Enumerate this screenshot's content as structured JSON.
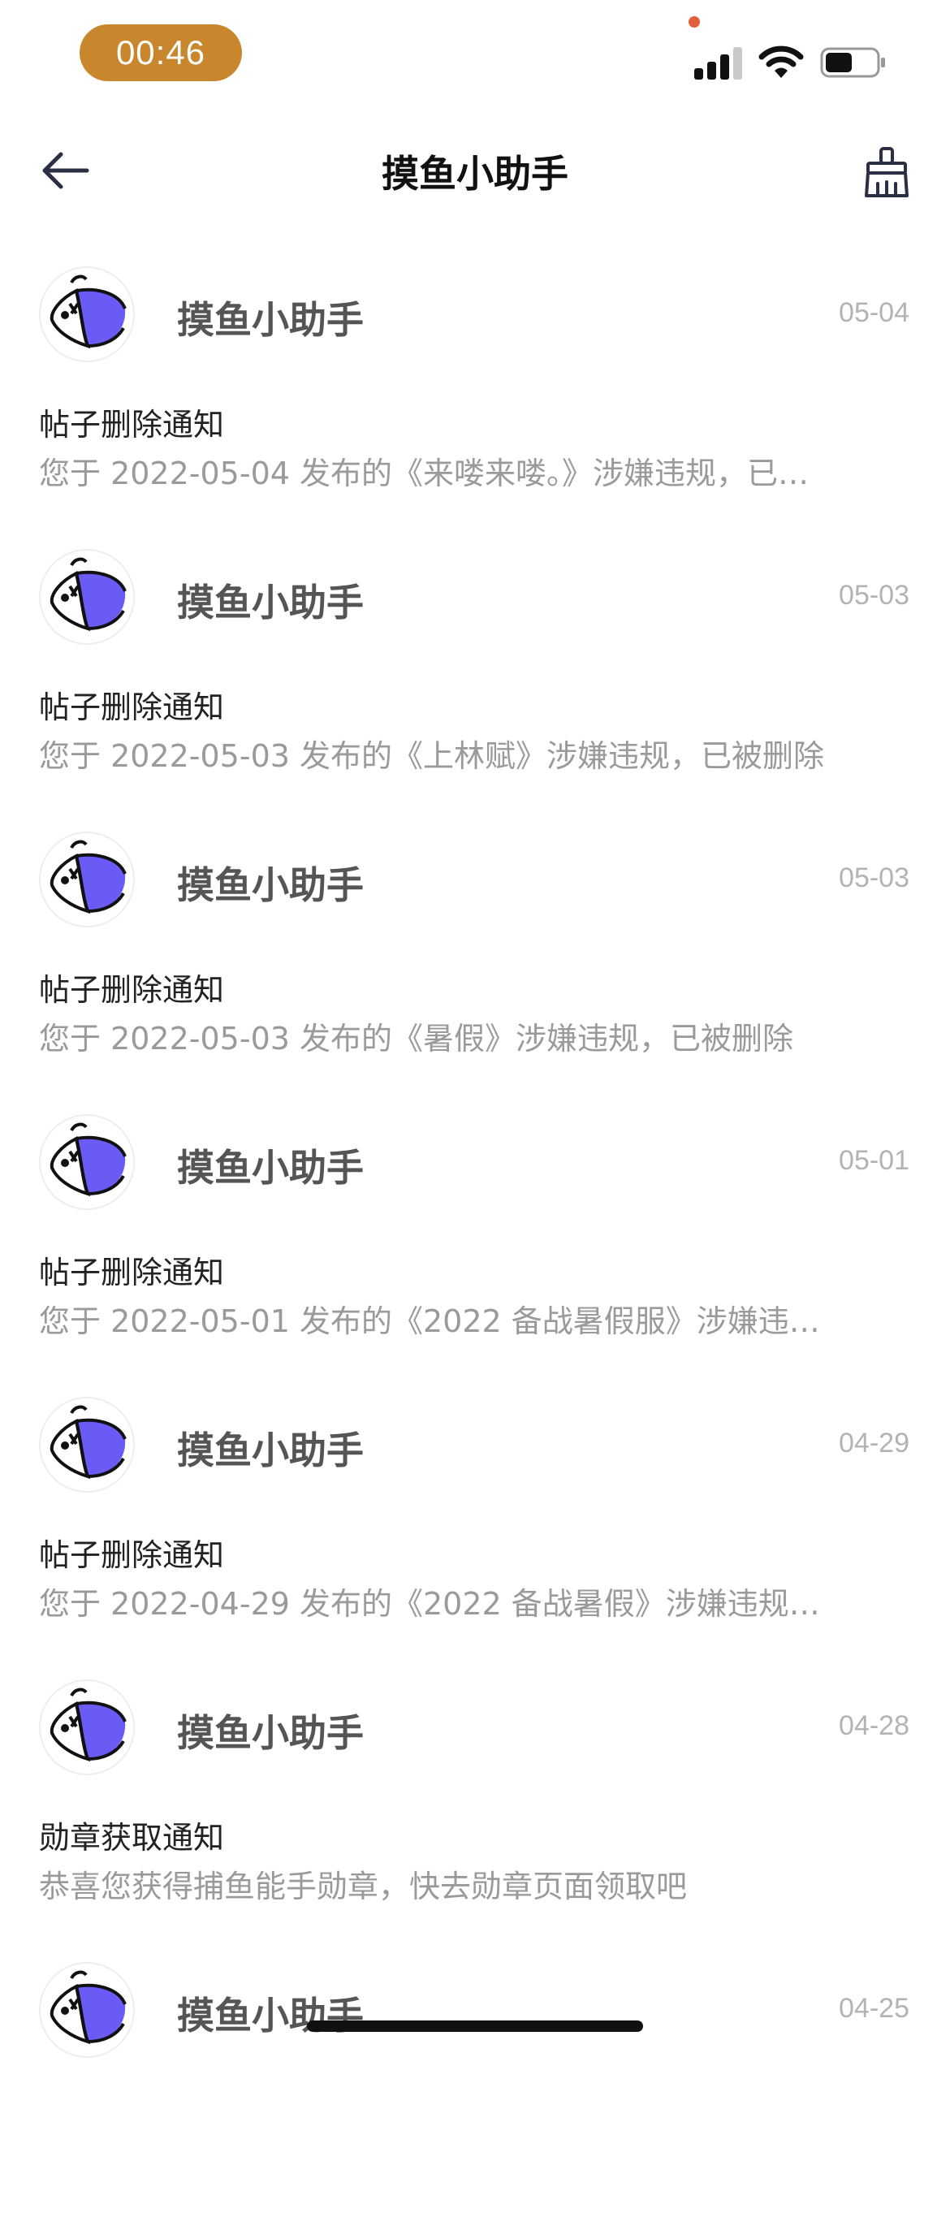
{
  "status_bar": {
    "time": "00:46"
  },
  "nav": {
    "title": "摸鱼小助手",
    "back_icon": "arrow-left-icon",
    "right_icon": "broom-icon"
  },
  "messages": [
    {
      "sender": "摸鱼小助手",
      "date": "05-04",
      "title": "帖子删除通知",
      "body": "您于 2022-05-04 发布的《来喽来喽。》涉嫌违规，已…"
    },
    {
      "sender": "摸鱼小助手",
      "date": "05-03",
      "title": "帖子删除通知",
      "body": "您于 2022-05-03 发布的《上林赋》涉嫌违规，已被删除"
    },
    {
      "sender": "摸鱼小助手",
      "date": "05-03",
      "title": "帖子删除通知",
      "body": "您于 2022-05-03 发布的《暑假》涉嫌违规，已被删除"
    },
    {
      "sender": "摸鱼小助手",
      "date": "05-01",
      "title": "帖子删除通知",
      "body": "您于 2022-05-01 发布的《2022 备战暑假服》涉嫌违…"
    },
    {
      "sender": "摸鱼小助手",
      "date": "04-29",
      "title": "帖子删除通知",
      "body": "您于 2022-04-29 发布的《2022 备战暑假》涉嫌违规…"
    },
    {
      "sender": "摸鱼小助手",
      "date": "04-28",
      "title": "勋章获取通知",
      "body": "恭喜您获得捕鱼能手勋章，快去勋章页面领取吧"
    },
    {
      "sender": "摸鱼小助手",
      "date": "04-25",
      "title": "",
      "body": ""
    }
  ],
  "colors": {
    "time_pill": "#C8862D",
    "avatar_accent": "#6B5BF5"
  }
}
